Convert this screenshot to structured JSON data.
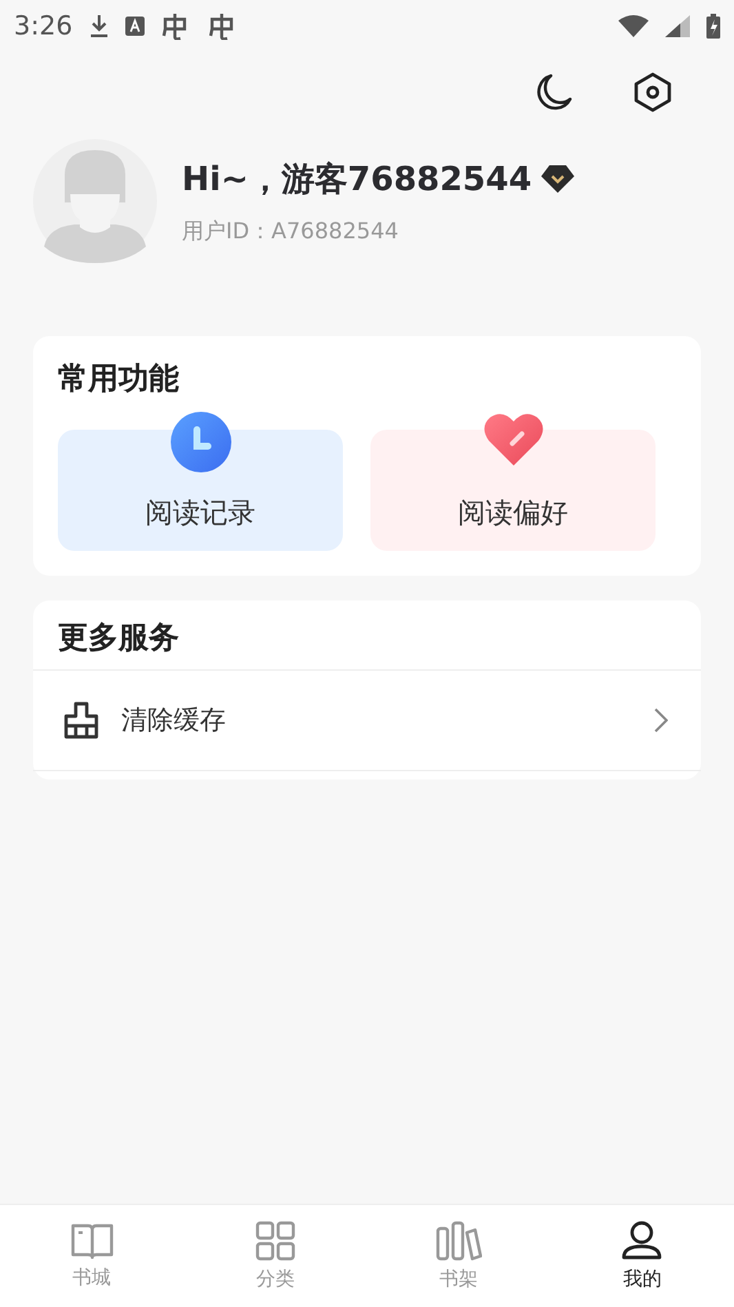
{
  "status_bar": {
    "time": "3:26"
  },
  "profile": {
    "greeting": "Hi~，游客76882544",
    "user_id": "用户ID：A76882544"
  },
  "common_functions": {
    "title": "常用功能",
    "items": [
      {
        "kind": "history",
        "label": "阅读记录"
      },
      {
        "kind": "preference",
        "label": "阅读偏好"
      }
    ]
  },
  "more_services": {
    "title": "更多服务",
    "items": [
      {
        "kind": "clear-cache",
        "label": "清除缓存"
      }
    ]
  },
  "bottom_nav": [
    {
      "kind": "store",
      "label": "书城",
      "selected": false
    },
    {
      "kind": "category",
      "label": "分类",
      "selected": false
    },
    {
      "kind": "shelf",
      "label": "书架",
      "selected": false
    },
    {
      "kind": "me",
      "label": "我的",
      "selected": true
    }
  ]
}
